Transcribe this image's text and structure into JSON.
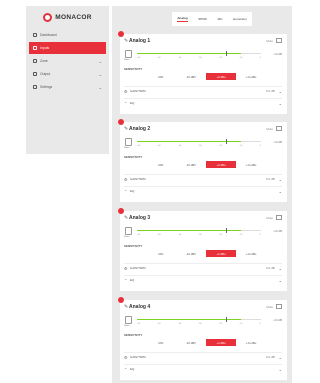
{
  "brand": {
    "name": "MONACOR",
    "accent": "#e8303a"
  },
  "sidebar": {
    "items": [
      {
        "label": "Dashboard",
        "active": false,
        "chevron": false
      },
      {
        "label": "Inputs",
        "active": true,
        "chevron": false
      },
      {
        "label": "Zone",
        "active": false,
        "chevron": true
      },
      {
        "label": "Output",
        "active": false,
        "chevron": true
      },
      {
        "label": "Settings",
        "active": false,
        "chevron": true
      }
    ]
  },
  "tabs": [
    "Analog",
    "SPDIF",
    "Mic",
    "Generator"
  ],
  "cards": [
    {
      "title": "Analog 1",
      "mute": "Mute",
      "meter_value": "-10 dB",
      "level": 0.84,
      "knob": 0.72,
      "meter_caption": "Meter",
      "ticks": [
        "-60",
        "-50",
        "-40",
        "-30",
        "-20",
        "-10",
        "0"
      ],
      "sensitivity_label": "SENSITIVITY",
      "sens": [
        "MIC",
        "-10 dBV",
        "+4 dBu",
        "+14 dBu"
      ],
      "sens_active": 2,
      "gain_label": "GAIN/TRIM",
      "gain_value": "0.0 dB",
      "eq_label": "EQ"
    },
    {
      "title": "Analog 2",
      "mute": "Mute",
      "meter_value": "-10 dB",
      "level": 0.84,
      "knob": 0.72,
      "meter_caption": "Meter",
      "ticks": [
        "-60",
        "-50",
        "-40",
        "-30",
        "-20",
        "-10",
        "0"
      ],
      "sensitivity_label": "SENSITIVITY",
      "sens": [
        "MIC",
        "-10 dBV",
        "+4 dBu",
        "+14 dBu"
      ],
      "sens_active": 2,
      "gain_label": "GAIN/TRIM",
      "gain_value": "0.0 dB",
      "eq_label": "EQ"
    },
    {
      "title": "Analog 3",
      "mute": "Mute",
      "meter_value": "-10 dB",
      "level": 0.84,
      "knob": 0.72,
      "meter_caption": "Meter",
      "ticks": [
        "-60",
        "-50",
        "-40",
        "-30",
        "-20",
        "-10",
        "0"
      ],
      "sensitivity_label": "SENSITIVITY",
      "sens": [
        "MIC",
        "-10 dBV",
        "+4 dBu",
        "+14 dBu"
      ],
      "sens_active": 2,
      "gain_label": "GAIN/TRIM",
      "gain_value": "0.0 dB",
      "eq_label": "EQ"
    },
    {
      "title": "Analog 4",
      "mute": "Mute",
      "meter_value": "-10 dB",
      "level": 0.84,
      "knob": 0.72,
      "meter_caption": "Meter",
      "ticks": [
        "-60",
        "-50",
        "-40",
        "-30",
        "-20",
        "-10",
        "0"
      ],
      "sensitivity_label": "SENSITIVITY",
      "sens": [
        "MIC",
        "-10 dBV",
        "+4 dBu",
        "+14 dBu"
      ],
      "sens_active": 2,
      "gain_label": "GAIN/TRIM",
      "gain_value": "0.0 dB",
      "eq_label": "EQ"
    }
  ]
}
